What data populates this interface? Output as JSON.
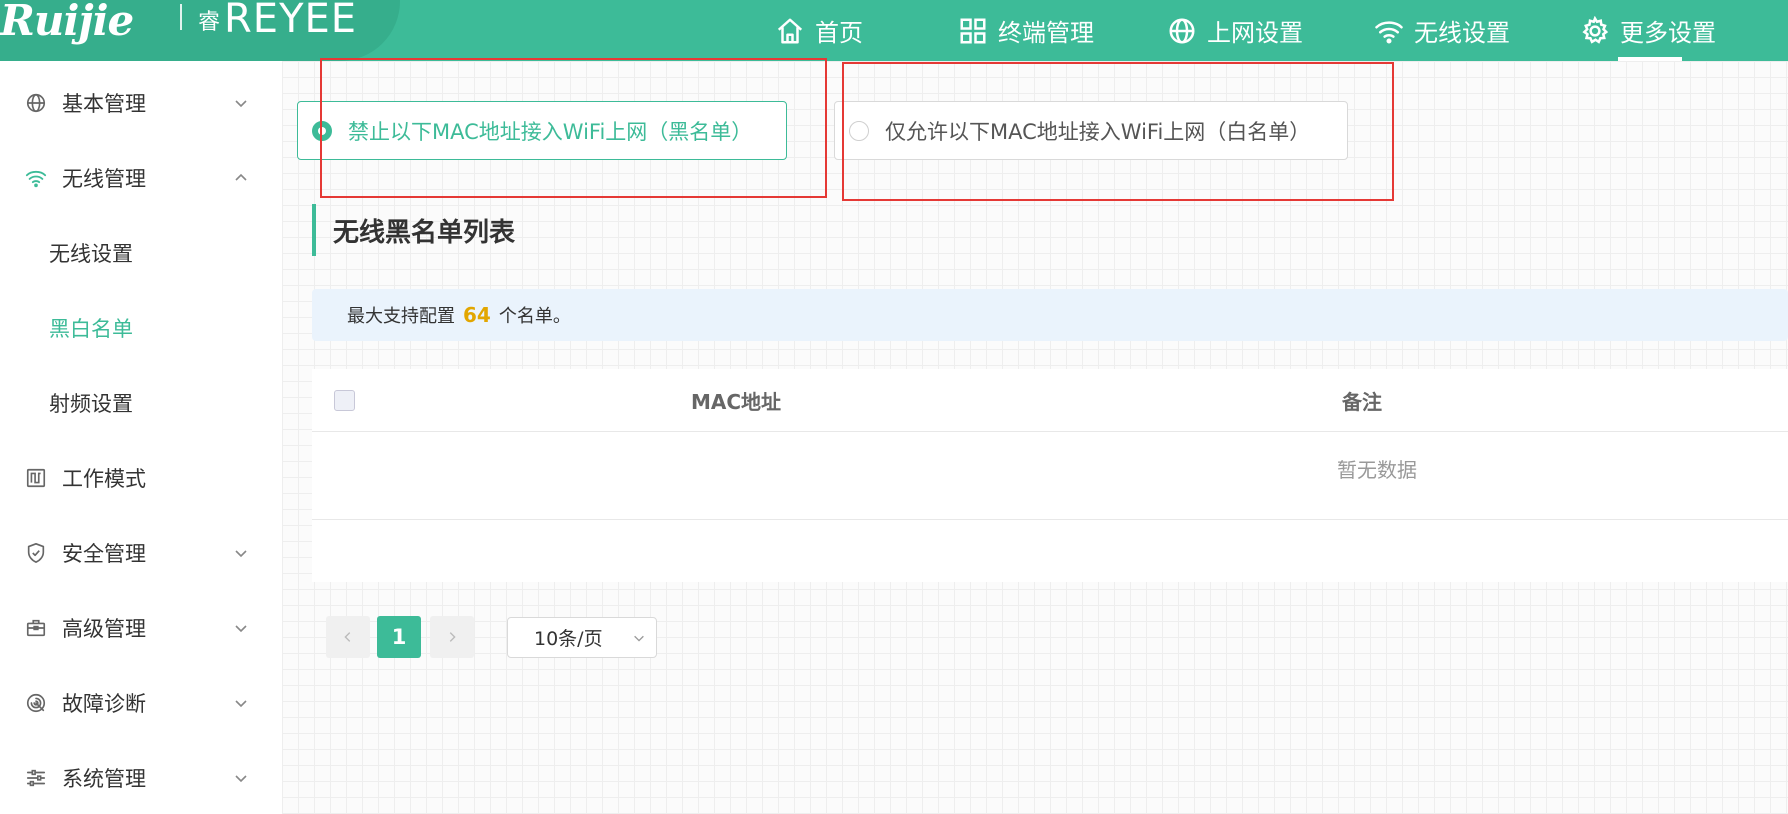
{
  "brand": {
    "name": "Ruijie",
    "sub_mark": "睿",
    "sub_name": "REYEE"
  },
  "top_nav": [
    {
      "label": "首页",
      "icon": "home-icon"
    },
    {
      "label": "终端管理",
      "icon": "grid-icon"
    },
    {
      "label": "上网设置",
      "icon": "globe-icon"
    },
    {
      "label": "无线设置",
      "icon": "wifi-icon"
    },
    {
      "label": "更多设置",
      "icon": "gear-icon",
      "active": true
    }
  ],
  "sidebar": {
    "items": [
      {
        "label": "基本管理",
        "icon": "globe-icon",
        "expanded": false
      },
      {
        "label": "无线管理",
        "icon": "wifi-icon",
        "expanded": true,
        "children": [
          {
            "label": "无线设置"
          },
          {
            "label": "黑白名单",
            "active": true
          },
          {
            "label": "射频设置"
          }
        ]
      },
      {
        "label": "工作模式",
        "icon": "mode-icon"
      },
      {
        "label": "安全管理",
        "icon": "shield-icon",
        "expanded": false
      },
      {
        "label": "高级管理",
        "icon": "toolbox-icon",
        "expanded": false
      },
      {
        "label": "故障诊断",
        "icon": "diagnose-icon",
        "expanded": false
      },
      {
        "label": "系统管理",
        "icon": "sliders-icon",
        "expanded": false
      }
    ]
  },
  "mode_options": {
    "blacklist": {
      "label": "禁止以下MAC地址接入WiFi上网（黑名单）",
      "checked": true
    },
    "whitelist": {
      "label": "仅允许以下MAC地址接入WiFi上网（白名单）",
      "checked": false
    }
  },
  "section": {
    "title": "无线黑名单列表"
  },
  "info": {
    "prefix": "最大支持配置",
    "count": "64",
    "suffix": "个名单。"
  },
  "table": {
    "columns": [
      "MAC地址",
      "备注"
    ],
    "rows": [],
    "empty_text": "暂无数据"
  },
  "pagination": {
    "current_page": "1",
    "page_size": "10条/页"
  },
  "colors": {
    "brand": "#3dbb98",
    "highlight_box": "#e53935",
    "count": "#e2a600"
  }
}
